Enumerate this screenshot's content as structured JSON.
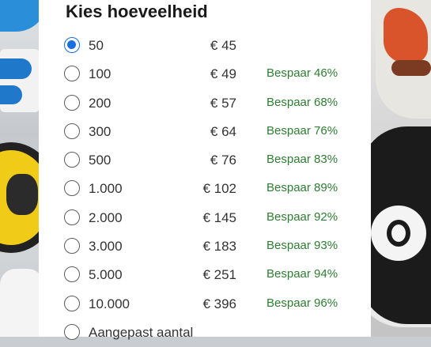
{
  "title": "Kies hoeveelheid",
  "options": [
    {
      "qty": "50",
      "price": "€ 45",
      "saving": "",
      "selected": true
    },
    {
      "qty": "100",
      "price": "€ 49",
      "saving": "Bespaar 46%",
      "selected": false
    },
    {
      "qty": "200",
      "price": "€ 57",
      "saving": "Bespaar 68%",
      "selected": false
    },
    {
      "qty": "300",
      "price": "€ 64",
      "saving": "Bespaar 76%",
      "selected": false
    },
    {
      "qty": "500",
      "price": "€ 76",
      "saving": "Bespaar 83%",
      "selected": false
    },
    {
      "qty": "1.000",
      "price": "€ 102",
      "saving": "Bespaar 89%",
      "selected": false
    },
    {
      "qty": "2.000",
      "price": "€ 145",
      "saving": "Bespaar 92%",
      "selected": false
    },
    {
      "qty": "3.000",
      "price": "€ 183",
      "saving": "Bespaar 93%",
      "selected": false
    },
    {
      "qty": "5.000",
      "price": "€ 251",
      "saving": "Bespaar 94%",
      "selected": false
    },
    {
      "qty": "10.000",
      "price": "€ 396",
      "saving": "Bespaar 96%",
      "selected": false
    },
    {
      "qty": "Aangepast aantal",
      "price": "",
      "saving": "",
      "selected": false
    }
  ],
  "colors": {
    "accent": "#1a6fe0",
    "saving": "#2e7d32"
  }
}
